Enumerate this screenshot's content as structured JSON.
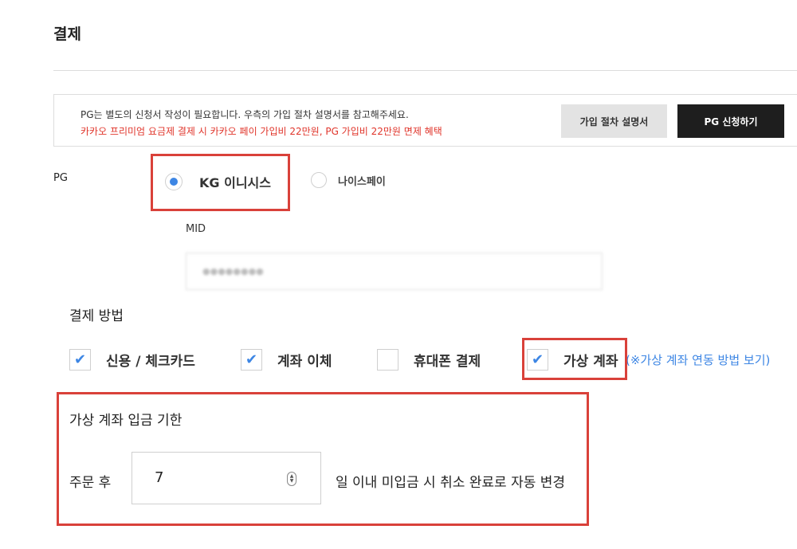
{
  "page": {
    "title": "결제"
  },
  "notice": {
    "line1": "PG는 별도의 신청서 작성이 필요합니다. 우측의 가입 절차 설명서를 참고해주세요.",
    "line2": "카카오 프리미엄 요금제 결제 시 카카오 페이 가입비 22만원, PG 가입비 22만원 면제 혜택",
    "guide_button": "가입 절차 설명서",
    "apply_button": "PG 신청하기"
  },
  "pg": {
    "label": "PG",
    "options": [
      {
        "label": "KG 이니시스",
        "selected": true
      },
      {
        "label": "나이스페이",
        "selected": false
      }
    ],
    "mid_label": "MID",
    "mid_value": "●●●●●●●●"
  },
  "payment_methods": {
    "title": "결제 방법",
    "items": [
      {
        "label": "신용 / 체크카드",
        "checked": true,
        "mark": "✔"
      },
      {
        "label": "계좌 이체",
        "checked": true,
        "mark": "✔"
      },
      {
        "label": "휴대폰 결제",
        "checked": false,
        "mark": ""
      },
      {
        "label": "가상 계좌",
        "checked": true,
        "mark": "✔"
      }
    ],
    "virtual_account_link": "(※가상 계좌 연동 방법 보기)"
  },
  "deadline": {
    "title": "가상 계좌 입금 기한",
    "prefix": "주문 후",
    "days": "7",
    "suffix": "일 이내 미입금 시 취소 완료로 자동 변경"
  },
  "colors": {
    "accent": "#3d86e4",
    "highlight": "#d9413a",
    "notice_red": "#e0352b",
    "dark_button": "#1e1e1e"
  }
}
